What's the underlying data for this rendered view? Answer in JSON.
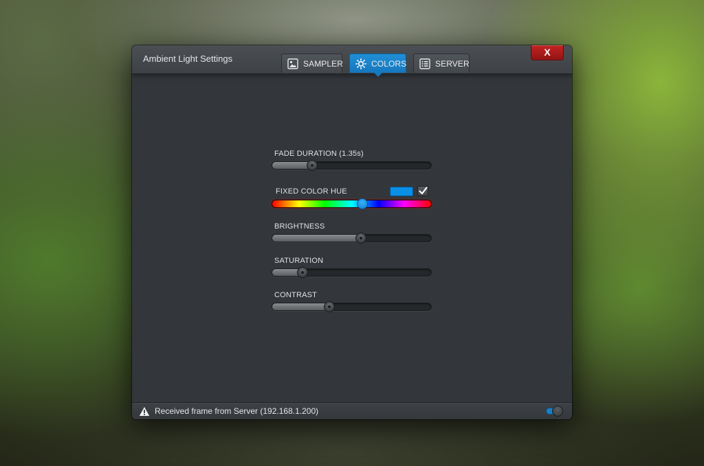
{
  "window": {
    "title": "Ambient Light Settings",
    "close_label": "X"
  },
  "tabs": [
    {
      "label": "SAMPLER",
      "icon": "image-icon",
      "active": false
    },
    {
      "label": "COLORS",
      "icon": "sun-icon",
      "active": true
    },
    {
      "label": "SERVER",
      "icon": "list-icon",
      "active": false
    }
  ],
  "settings": {
    "fade_duration": {
      "label": "FADE DURATION (1.35s)",
      "value": 0.25
    },
    "fixed_color_hue": {
      "label": "FIXED COLOR HUE",
      "value": 0.565,
      "swatch_color": "#0a8fe6",
      "enabled": true
    },
    "brightness": {
      "label": "BRIGHTNESS",
      "value": 0.56
    },
    "saturation": {
      "label": "SATURATION",
      "value": 0.19
    },
    "contrast": {
      "label": "CONTRAST",
      "value": 0.36
    }
  },
  "status": {
    "icon": "warning-icon",
    "text": "Received frame from Server (192.168.1.200)",
    "toggle_on": true
  },
  "colors": {
    "accent": "#1a82c9",
    "close": "#b01b1b",
    "panel": "#33373b"
  }
}
